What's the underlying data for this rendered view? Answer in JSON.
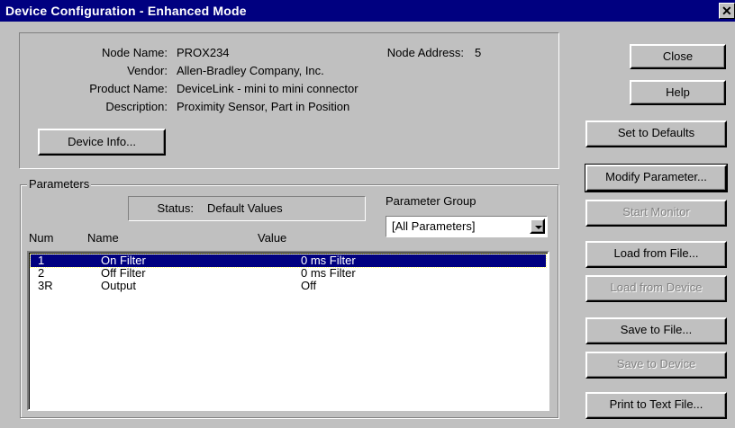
{
  "window": {
    "title": "Device Configuration - Enhanced Mode",
    "close_glyph": "✕"
  },
  "device": {
    "node_name_label": "Node Name:",
    "node_name": "PROX234",
    "node_address_label": "Node Address:",
    "node_address": "5",
    "vendor_label": "Vendor:",
    "vendor": "Allen-Bradley Company, Inc.",
    "product_label": "Product Name:",
    "product": "DeviceLink - mini to mini connector",
    "description_label": "Description:",
    "description": "Proximity Sensor, Part in Position",
    "info_button": "Device Info...",
    "info_button_mnemonic": "I"
  },
  "parameters": {
    "group_title": "Parameters",
    "status_label": "Status:",
    "status_value": "Default Values",
    "group_label": "Parameter Group",
    "group_mnemonic": "G",
    "group_selected": "[All Parameters]",
    "columns": {
      "num": "Num",
      "name": "Name",
      "value": "Value"
    },
    "rows": [
      {
        "num": "1",
        "name": "On Filter",
        "value": "0 ms Filter",
        "selected": true
      },
      {
        "num": "2",
        "name": "Off Filter",
        "value": "0 ms Filter",
        "selected": false
      },
      {
        "num": "3R",
        "name": "Output",
        "value": "Off",
        "selected": false
      }
    ]
  },
  "buttons": {
    "close": "Close",
    "help": "Help",
    "set_defaults": "Set to Defaults",
    "modify": "Modify Parameter...",
    "start_monitor": "Start Monitor",
    "load_file": "Load from File...",
    "load_device": "Load from Device",
    "save_file": "Save to File...",
    "save_device": "Save to Device",
    "print_text": "Print to Text File..."
  },
  "colors": {
    "title_bar": "#000080",
    "face": "#c0c0c0",
    "selection": "#000080",
    "disabled_text": "#808080"
  }
}
